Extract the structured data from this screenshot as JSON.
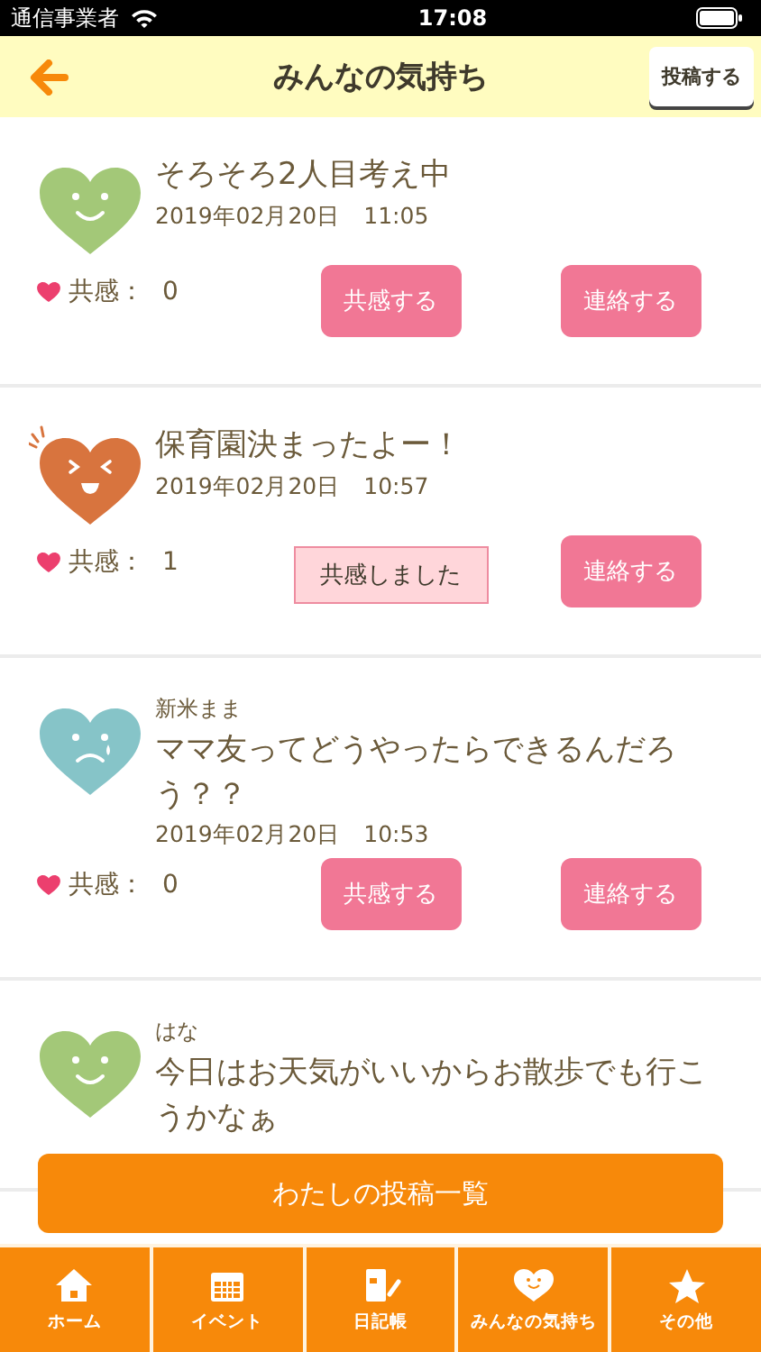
{
  "status_bar": {
    "carrier": "通信事業者",
    "time": "17:08"
  },
  "header": {
    "title": "みんなの気持ち",
    "post_button": "投稿する"
  },
  "posts": [
    {
      "kind": "smile",
      "color": "#a3c878",
      "title": "そろそろ2人目考え中",
      "date": "2019年02月20日　11:05",
      "like_label": "共感：",
      "like_count": "0",
      "like_button": "共感する",
      "liked": false,
      "contact_button": "連絡する"
    },
    {
      "kind": "wink",
      "color": "#d8743e",
      "title": "保育園決まったよー！",
      "date": "2019年02月20日　10:57",
      "like_label": "共感：",
      "like_count": "1",
      "like_button": "共感しました",
      "liked": true,
      "contact_button": "連絡する"
    },
    {
      "kind": "sad",
      "color": "#86c4c8",
      "author": "新米まま",
      "title": "ママ友ってどうやったらできるんだろう？？",
      "date": "2019年02月20日　10:53",
      "like_label": "共感：",
      "like_count": "0",
      "like_button": "共感する",
      "liked": false,
      "contact_button": "連絡する"
    },
    {
      "kind": "smile",
      "color": "#a3c878",
      "author": "はな",
      "title": "今日はお天気がいいからお散歩でも行こうかなぁ"
    }
  ],
  "my_posts_button": "わたしの投稿一覧",
  "tabs": [
    {
      "label": "ホーム",
      "kind": "home"
    },
    {
      "label": "イベント",
      "kind": "calendar"
    },
    {
      "label": "日記帳",
      "kind": "notebook"
    },
    {
      "label": "みんなの気持ち",
      "kind": "heart"
    },
    {
      "label": "その他",
      "kind": "star"
    }
  ]
}
